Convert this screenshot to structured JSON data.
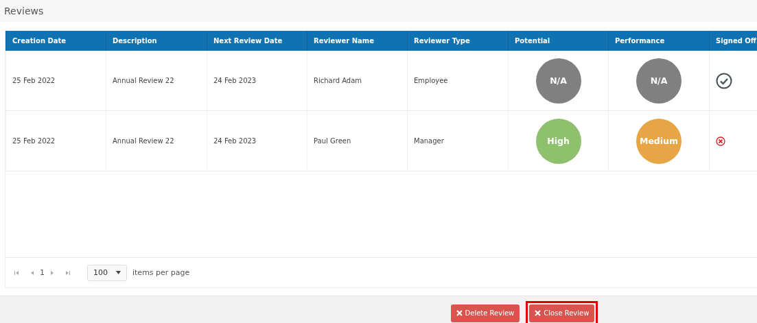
{
  "panel": {
    "title": "Reviews"
  },
  "table": {
    "columns": [
      "Creation Date",
      "Description",
      "Next Review Date",
      "Reviewer Name",
      "Reviewer Type",
      "Potential",
      "Performance",
      "Signed Off"
    ],
    "rows": [
      {
        "creation_date": "25 Feb 2022",
        "description": "Annual Review 22",
        "next_review_date": "24 Feb 2023",
        "reviewer_name": "Richard Adam",
        "reviewer_type": "Employee",
        "potential": {
          "label": "N/A",
          "color": "#808080"
        },
        "performance": {
          "label": "N/A",
          "color": "#808080"
        },
        "signed_off": true
      },
      {
        "creation_date": "25 Feb 2022",
        "description": "Annual Review 22",
        "next_review_date": "24 Feb 2023",
        "reviewer_name": "Paul Green",
        "reviewer_type": "Manager",
        "potential": {
          "label": "High",
          "color": "#8fc06e"
        },
        "performance": {
          "label": "Medium",
          "color": "#e8a545"
        },
        "signed_off": false
      }
    ]
  },
  "pager": {
    "page": "1",
    "page_size": "100",
    "label": "items per page"
  },
  "buttons": [
    {
      "label": "Delete Review",
      "highlighted": false
    },
    {
      "label": "Close Review",
      "highlighted": true
    }
  ]
}
